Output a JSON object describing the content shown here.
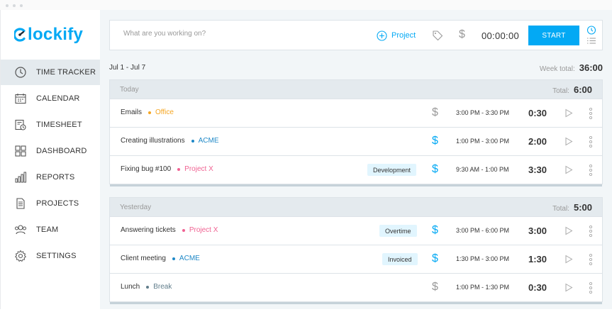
{
  "app": {
    "logo_text": "lockify",
    "brand_color": "#03a9f4"
  },
  "sidebar": {
    "items": [
      {
        "label": "TIME TRACKER",
        "icon": "clock-icon",
        "active": true
      },
      {
        "label": "CALENDAR",
        "icon": "calendar-icon",
        "active": false
      },
      {
        "label": "TIMESHEET",
        "icon": "timesheet-icon",
        "active": false
      },
      {
        "label": "DASHBOARD",
        "icon": "dashboard-icon",
        "active": false
      },
      {
        "label": "REPORTS",
        "icon": "reports-icon",
        "active": false
      },
      {
        "label": "PROJECTS",
        "icon": "projects-icon",
        "active": false
      },
      {
        "label": "TEAM",
        "icon": "team-icon",
        "active": false
      },
      {
        "label": "SETTINGS",
        "icon": "gear-icon",
        "active": false
      }
    ]
  },
  "timer": {
    "placeholder": "What are you working on?",
    "project_label": "Project",
    "billable_symbol": "$",
    "elapsed": "00:00:00",
    "start_label": "START"
  },
  "week": {
    "range": "Jul 1 - Jul 7",
    "total_label": "Week total:",
    "total": "36:00"
  },
  "groups": [
    {
      "day": "Today",
      "total_label": "Total:",
      "total": "6:00",
      "entries": [
        {
          "description": "Emails",
          "project": "Office",
          "project_color": "#f5a623",
          "tag": "",
          "billable": false,
          "time_range": "3:00 PM - 3:30 PM",
          "duration": "0:30"
        },
        {
          "description": "Creating illustrations",
          "project": "ACME",
          "project_color": "#1e88c7",
          "tag": "",
          "billable": true,
          "time_range": "1:00 PM - 3:00 PM",
          "duration": "2:00"
        },
        {
          "description": "Fixing bug #100",
          "project": "Project X",
          "project_color": "#f06292",
          "tag": "Development",
          "billable": true,
          "time_range": "9:30 AM - 1:00 PM",
          "duration": "3:30"
        }
      ]
    },
    {
      "day": "Yesterday",
      "total_label": "Total:",
      "total": "5:00",
      "entries": [
        {
          "description": "Answering tickets",
          "project": "Project X",
          "project_color": "#f06292",
          "tag": "Overtime",
          "billable": true,
          "time_range": "3:00 PM - 6:00 PM",
          "duration": "3:00"
        },
        {
          "description": "Client meeting",
          "project": "ACME",
          "project_color": "#1e88c7",
          "tag": "Invoiced",
          "billable": true,
          "time_range": "1:30 PM - 3:00 PM",
          "duration": "1:30"
        },
        {
          "description": "Lunch",
          "project": "Break",
          "project_color": "#607d8b",
          "tag": "",
          "billable": false,
          "time_range": "1:00 PM - 1:30 PM",
          "duration": "0:30"
        }
      ]
    }
  ],
  "colors": {
    "billable_active": "#03a9f4",
    "billable_inactive": "#999999"
  }
}
